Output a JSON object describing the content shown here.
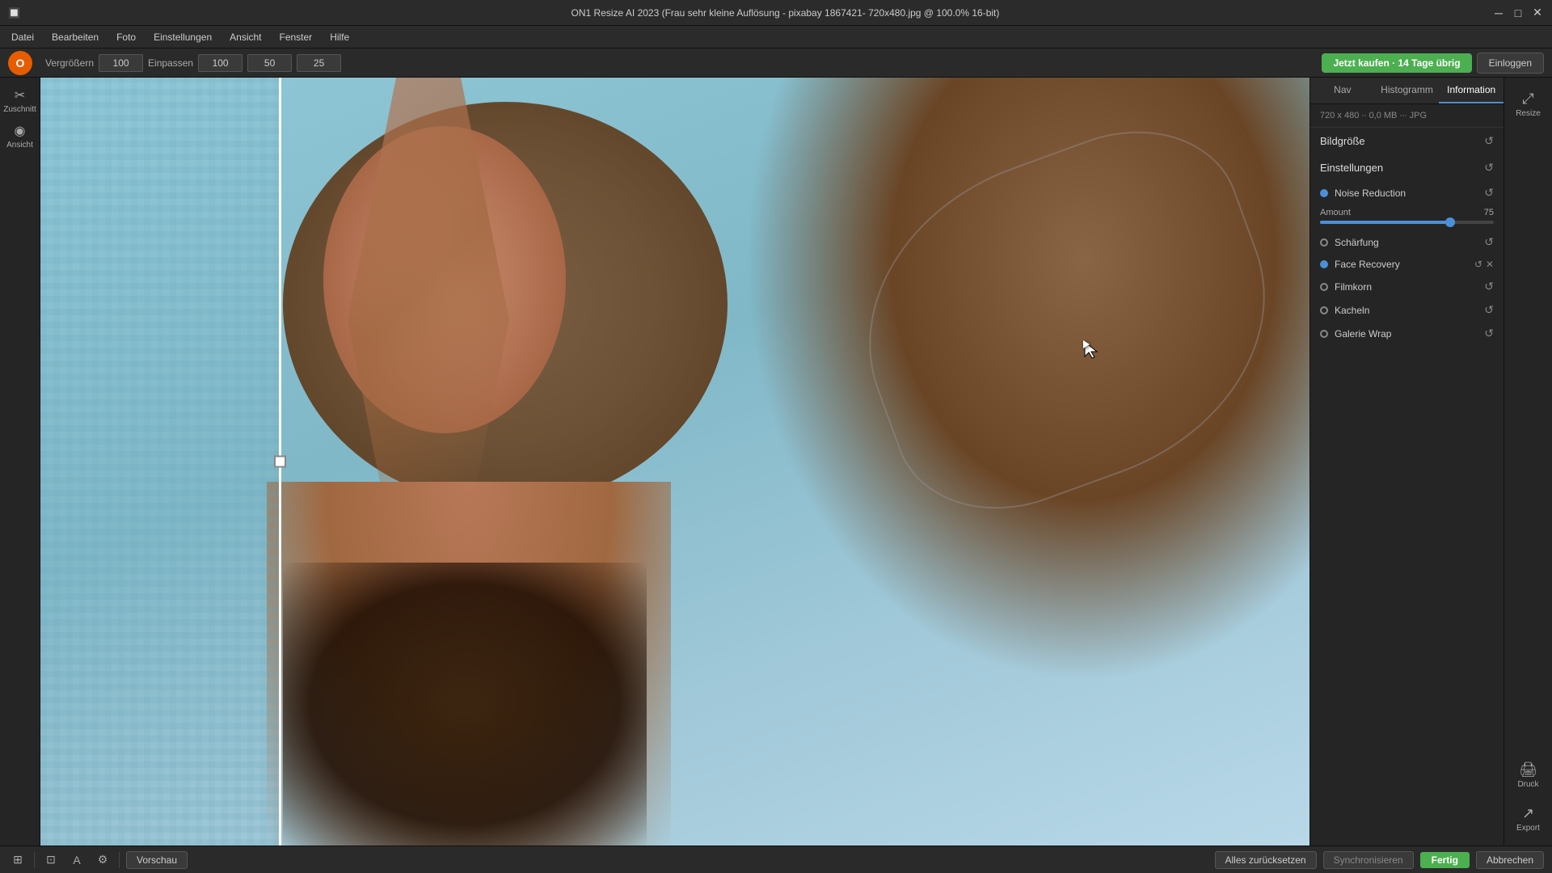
{
  "titlebar": {
    "title": "ON1 Resize AI 2023 (Frau sehr kleine Auflösung - pixabay 1867421- 720x480.jpg @ 100.0% 16-bit)",
    "minimize": "─",
    "maximize": "□",
    "close": "✕"
  },
  "menubar": {
    "items": [
      "Datei",
      "Bearbeiten",
      "Foto",
      "Einstellungen",
      "Ansicht",
      "Fenster",
      "Hilfe"
    ]
  },
  "toolbar": {
    "logo": "O",
    "vergrossern_label": "Vergrößern",
    "vergrossern_value": "100",
    "einpassen_label": "Einpassen",
    "einpassen_value": "100",
    "field2_value": "50",
    "field3_value": "25",
    "buy_btn": "Jetzt kaufen · 14 Tage übrig",
    "login_btn": "Einloggen"
  },
  "left_sidebar": {
    "tools": [
      {
        "name": "zuschnitt",
        "icon": "⊞",
        "label": "Zuschnitt"
      },
      {
        "name": "ansicht",
        "icon": "◉",
        "label": "Ansicht"
      }
    ]
  },
  "right_panel": {
    "tabs": [
      {
        "id": "nav",
        "label": "Nav"
      },
      {
        "id": "histogram",
        "label": "Histogramm"
      },
      {
        "id": "information",
        "label": "Information"
      }
    ],
    "active_tab": "information",
    "image_info": "720 x 480 ∙∙ 0,0 MB ∙∙∙ JPG",
    "sections": {
      "bildgrosse": {
        "label": "Bildgröße"
      },
      "einstellungen": {
        "label": "Einstellungen"
      },
      "noise_reduction": {
        "label": "Noise Reduction",
        "active": true,
        "amount_label": "Amount",
        "amount_value": "75",
        "slider_percent": 75
      },
      "schärfung": {
        "label": "Schärfung",
        "active": false
      },
      "face_recovery": {
        "label": "Face Recovery",
        "active": true
      },
      "filmkorn": {
        "label": "Filmkorn",
        "active": false
      },
      "kacheln": {
        "label": "Kacheln",
        "active": false
      },
      "galerie_wrap": {
        "label": "Galerie Wrap",
        "active": false
      }
    }
  },
  "far_right": {
    "buttons": [
      {
        "name": "resize",
        "icon": "⤢",
        "label": "Resize"
      },
      {
        "name": "druck",
        "icon": "🖨",
        "label": "Druck"
      },
      {
        "name": "export",
        "icon": "↗",
        "label": "Export"
      }
    ]
  },
  "statusbar": {
    "preview_btn": "Vorschau",
    "reset_all_btn": "Alles zurücksetzen",
    "sync_btn": "Synchronisieren",
    "fertig_btn": "Fertig",
    "abbrechen_btn": "Abbrechen"
  }
}
